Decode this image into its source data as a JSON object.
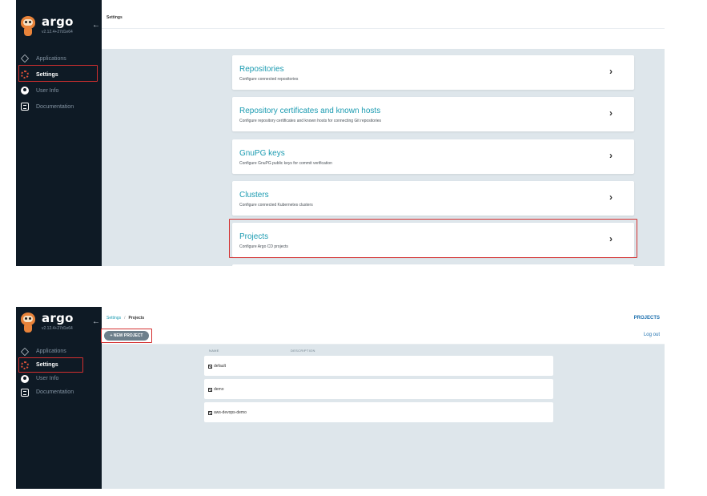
{
  "sidebar": {
    "brand": "argo",
    "version": "v2.12.4+27d1e64",
    "items": [
      {
        "label": "Applications",
        "icon": "applications-icon"
      },
      {
        "label": "Settings",
        "icon": "settings-gear-icon"
      },
      {
        "label": "User Info",
        "icon": "user-icon"
      },
      {
        "label": "Documentation",
        "icon": "documentation-icon"
      }
    ]
  },
  "settings": {
    "title": "Settings",
    "cards": [
      {
        "title": "Repositories",
        "desc": "Configure connected repositories"
      },
      {
        "title": "Repository certificates and known hosts",
        "desc": "Configure repository certificates and known hosts for connecting Git repositories"
      },
      {
        "title": "GnuPG keys",
        "desc": "Configure GnuPG public keys for commit verification"
      },
      {
        "title": "Clusters",
        "desc": "Configure connected Kubernetes clusters"
      },
      {
        "title": "Projects",
        "desc": "Configure Argo CD projects"
      }
    ],
    "chevron": "›"
  },
  "projects_page": {
    "breadcrumb": {
      "root": "Settings",
      "separator": "/",
      "current": "Projects"
    },
    "heading": "PROJECTS",
    "new_button": "+ NEW PROJECT",
    "logout": "Log out",
    "columns": {
      "name": "NAME",
      "description": "DESCRIPTION"
    },
    "rows": [
      {
        "name": "default"
      },
      {
        "name": "demo"
      },
      {
        "name": "aws-devops-demo"
      }
    ]
  },
  "colors": {
    "sidebar_bg": "#0e1a25",
    "accent": "#1b9bb1",
    "highlight": "#d32f2f",
    "content_bg": "#dee6eb"
  }
}
